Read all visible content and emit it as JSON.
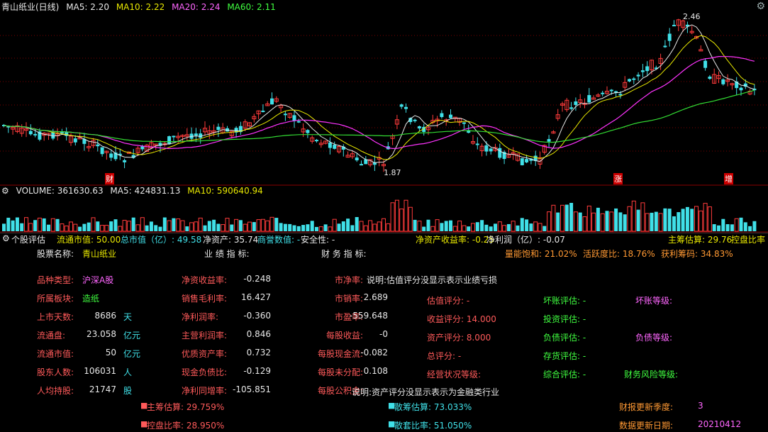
{
  "price_header": {
    "title": "青山纸业(日线)",
    "ma5": "MA5: 2.20",
    "ma10": "MA10: 2.22",
    "ma20": "MA20: 2.24",
    "ma60": "MA60: 2.11",
    "high_label": "2.46",
    "low_label": "1.87",
    "marker_cai": "财",
    "marker_zhang": "涨",
    "marker_zeng": "增"
  },
  "volume_header": {
    "volume": "VOLUME: 361630.63",
    "ma5": "MA5: 424831.13",
    "ma10": "MA10: 590640.94"
  },
  "colors": {
    "up": "#ff3b3b",
    "down": "#40e0e8",
    "ma5": "#e8e8e8",
    "ma10": "#e8e800",
    "ma20": "#ff33ff",
    "ma60": "#33dd33"
  },
  "info_bar": {
    "panel_title": "个股评估",
    "circ_mv": "流通市值: 50.00",
    "total_mv": "总市值（亿）: 49.58",
    "net_assets": "净资产: 35.74",
    "goodwill": "商誉数值: -",
    "safety": "安全性: -",
    "roe": "净资产收益率: -0.25",
    "net_profit": "净利润（亿）: -0.07",
    "main_est": "主筹估算: 29.76",
    "ctrl_ratio": "控盘比率"
  },
  "left_table": {
    "stock_name_label": "股票名称:",
    "stock_name": "青山纸业",
    "rows": [
      {
        "label": "品种类型:",
        "value": "沪深A股",
        "unit": ""
      },
      {
        "label": "所属板块:",
        "value": "造纸",
        "unit": ""
      },
      {
        "label": "上市天数:",
        "value": "8686",
        "unit": "天"
      },
      {
        "label": "流通盘:",
        "value": "23.058",
        "unit": "亿元"
      },
      {
        "label": "流通市值:",
        "value": "50",
        "unit": "亿元"
      },
      {
        "label": "股东人数:",
        "value": "106031",
        "unit": "人"
      },
      {
        "label": "人均持股:",
        "value": "21747",
        "unit": "股"
      }
    ]
  },
  "perf_table": {
    "title": "业 绩 指 标:",
    "rows": [
      {
        "label": "净资收益率:",
        "value": "-0.248"
      },
      {
        "label": "销售毛利率:",
        "value": "16.427"
      },
      {
        "label": "净利润率:",
        "value": "-0.360"
      },
      {
        "label": "主营利润率:",
        "value": "0.846"
      },
      {
        "label": "优质资产率:",
        "value": "0.732"
      },
      {
        "label": "现金负债比:",
        "value": "-0.129"
      },
      {
        "label": "净利同增率:",
        "value": "-105.851"
      }
    ]
  },
  "fin_table": {
    "title": "财 务 指 标:",
    "rows": [
      {
        "label": "市净率:",
        "value": ""
      },
      {
        "label": "市销率:",
        "value": "2.689"
      },
      {
        "label": "市盈率:",
        "value": "-559.648"
      },
      {
        "label": "每股收益:",
        "value": "-0"
      },
      {
        "label": "每股现金流:",
        "value": "-0.082"
      },
      {
        "label": "每股未分配:",
        "value": "0.108"
      },
      {
        "label": "每股公积金:",
        "value": ""
      }
    ],
    "note_top": "说明:估值评分没显示表示业绩亏损",
    "note_bottom": "说明:资产评分没显示表示为金融类行业"
  },
  "right_top": {
    "volume_sat": "量能饱和: 21.02%",
    "activity": "活跃度比: 18.76%",
    "profit_chips": "获利筹码: 34.83%"
  },
  "score_table": {
    "rows": [
      {
        "label": "估值评分: -"
      },
      {
        "label": "收益评分: 14.000"
      },
      {
        "label": "资产评分: 8.000"
      },
      {
        "label": "总评分: -"
      },
      {
        "label": "经营状况等级:"
      }
    ]
  },
  "eval_table": {
    "rows": [
      {
        "label": "坏账评估: -"
      },
      {
        "label": "投资评估: -"
      },
      {
        "label": "负债评估: -"
      },
      {
        "label": "存货评估: -"
      },
      {
        "label": "综合评估: -"
      }
    ]
  },
  "grade_table": {
    "bad_debt": "坏账等级:",
    "debt": "负债等级:",
    "risk": "财务风险等级:"
  },
  "bottom_stats": {
    "main_est": "主筹估算: 29.759%",
    "ctrl_ratio": "控盘比率: 28.950%",
    "retail_est": "散筹估算: 73.033%",
    "retail_ratio": "散套比率: 51.050%",
    "report_season_label": "财报更新季度:",
    "report_season": "3",
    "data_date_label": "数据更新日期:",
    "data_date": "20210412"
  }
}
